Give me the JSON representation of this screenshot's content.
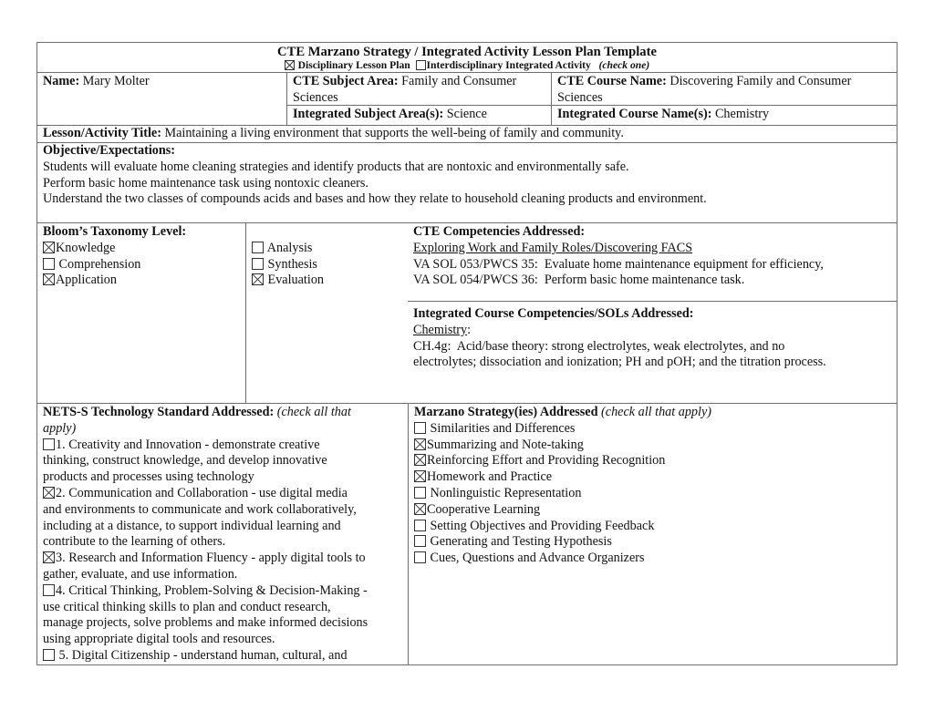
{
  "header": {
    "title": "CTE Marzano Strategy / Integrated Activity Lesson Plan Template",
    "options": [
      {
        "label": "Disciplinary Lesson Plan",
        "checked": true
      },
      {
        "label": "Interdisciplinary Integrated Activity",
        "checked": false
      }
    ],
    "check_note": "(check one)"
  },
  "info": {
    "name_label": "Name:",
    "name_value": "Mary Molter",
    "cte_subject_label": "CTE Subject Area:",
    "cte_subject_value_1": "Family and Consumer",
    "cte_subject_value_2": "Sciences",
    "cte_course_label": "CTE Course Name:",
    "cte_course_value_1": "Discovering Family and Consumer",
    "cte_course_value_2": "Sciences",
    "integrated_subject_label": "Integrated Subject Area(s):",
    "integrated_subject_value": "Science",
    "integrated_course_label": "Integrated Course Name(s):",
    "integrated_course_value": "Chemistry"
  },
  "lesson": {
    "title_label": "Lesson/Activity Title:",
    "title_value": "Maintaining a living environment that supports the well-being of family and community."
  },
  "objective": {
    "label": "Objective/Expectations:",
    "lines": [
      "Students will evaluate home cleaning strategies and identify products that are nontoxic and environmentally safe.",
      "Perform basic home maintenance task using nontoxic cleaners.",
      "Understand the two classes of compounds acids and bases and how they relate to household cleaning products and environment."
    ]
  },
  "blooms": {
    "label": "Bloom’s Taxonomy Level:",
    "col1": [
      {
        "label": "Knowledge",
        "checked": true
      },
      {
        "label": "Comprehension",
        "checked": false
      },
      {
        "label": "Application",
        "checked": true
      }
    ],
    "col2": [
      {
        "label": "Analysis",
        "checked": false
      },
      {
        "label": "Synthesis",
        "checked": false
      },
      {
        "label": "Evaluation",
        "checked": true
      }
    ]
  },
  "cte_competencies": {
    "label": "CTE Competencies Addressed:",
    "subheading": "Exploring Work and Family Roles/Discovering FACS",
    "lines": [
      "VA SOL 053/PWCS 35:  Evaluate home maintenance equipment for efficiency,",
      "VA SOL 054/PWCS 36:  Perform basic home maintenance task."
    ]
  },
  "integrated_competencies": {
    "label": "Integrated Course Competencies/SOLs Addressed:",
    "subheading": "Chemistry",
    "subheading_suffix": ":",
    "lines": [
      "CH.4g:  Acid/base theory: strong electrolytes, weak electrolytes, and no",
      "electrolytes; dissociation and ionization; PH and pOH; and the titration process."
    ]
  },
  "nets": {
    "label": "NETS-S Technology Standard Addressed:",
    "note": "(check all that",
    "note_2": "apply)",
    "items": [
      {
        "checked": false,
        "lines": [
          "1. Creativity and Innovation - demonstrate creative",
          "thinking, construct knowledge, and develop innovative",
          "products and processes using technology"
        ]
      },
      {
        "checked": true,
        "lines": [
          "2. Communication and Collaboration - use digital media",
          "and environments to communicate and work collaboratively,",
          "including at a distance, to support individual learning and",
          "contribute to the learning of others."
        ]
      },
      {
        "checked": true,
        "lines": [
          "3. Research and Information Fluency - apply digital tools to",
          "gather, evaluate, and use information."
        ]
      },
      {
        "checked": false,
        "lines": [
          "4. Critical Thinking, Problem-Solving & Decision-Making -",
          "use critical thinking skills to plan and conduct research,",
          "manage projects, solve problems and make informed decisions",
          "using appropriate digital tools and resources."
        ]
      },
      {
        "checked": false,
        "lines": [
          " 5. Digital Citizenship - understand human, cultural, and"
        ]
      }
    ]
  },
  "marzano": {
    "label": "Marzano Strategy(ies) Addressed",
    "note": "(check all that apply)",
    "items": [
      {
        "label": "Similarities and Differences",
        "checked": false
      },
      {
        "label": "Summarizing and Note-taking",
        "checked": true
      },
      {
        "label": "Reinforcing Effort and Providing Recognition",
        "checked": true
      },
      {
        "label": "Homework and Practice",
        "checked": true
      },
      {
        "label": "Nonlinguistic Representation",
        "checked": false
      },
      {
        "label": "Cooperative Learning",
        "checked": true
      },
      {
        "label": "Setting Objectives and Providing Feedback",
        "checked": false
      },
      {
        "label": "Generating and Testing Hypothesis",
        "checked": false
      },
      {
        "label": "Cues, Questions and Advance Organizers",
        "checked": false
      }
    ]
  }
}
